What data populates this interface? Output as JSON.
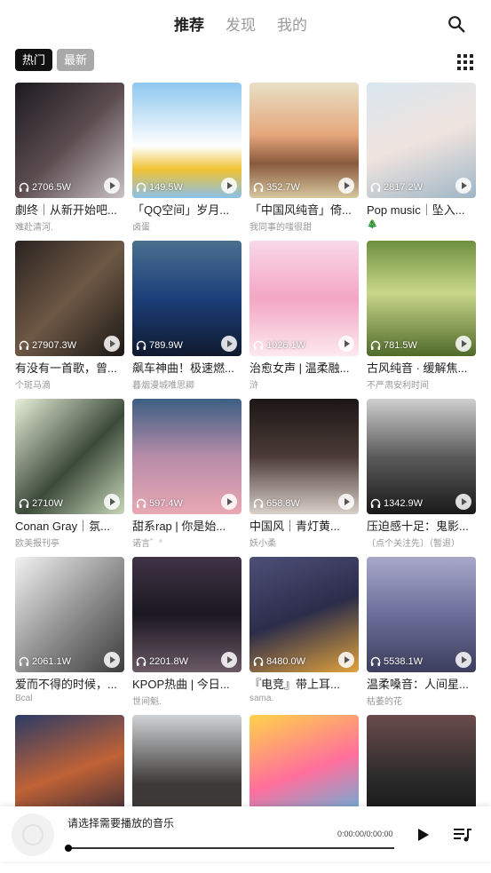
{
  "nav": {
    "tabs": [
      "推荐",
      "发现",
      "我的"
    ],
    "active": 0
  },
  "filters": {
    "hot": "热门",
    "new": "最新"
  },
  "colors": {
    "accent": "#111111",
    "chip_inactive": "#a9a9a9"
  },
  "playlists": [
    {
      "count": "2706.5W",
      "title": "劇终｜从新开始吧...",
      "sub": "难赴清河.",
      "bg": "linear-gradient(135deg,#1b1b1f,#5b4b4f 50%,#c9c1c5)"
    },
    {
      "count": "149.5W",
      "title": "「QQ空间」岁月...",
      "sub": "卤蛋",
      "bg": "linear-gradient(180deg,#8ec7ef,#fff 55%,#f0c233 75%,#8ac0e8)"
    },
    {
      "count": "352.7W",
      "title": "「中国风纯音」倚...",
      "sub": "我同事的嗤很甜",
      "bg": "linear-gradient(180deg,#e7e0c6,#e6a77c 45%,#8a5a3d 70%,#d6c79f)"
    },
    {
      "count": "2817.2W",
      "title": "Pop music｜坠入...",
      "sub": "🎄",
      "bg": "linear-gradient(160deg,#d9e6ef,#f0e4de 50%,#9fb6c6)"
    },
    {
      "count": "27907.3W",
      "title": "有没有一首歌，曾...",
      "sub": "个斑马滴",
      "bg": "linear-gradient(135deg,#2a2320,#6e5845 50%,#1c1816)"
    },
    {
      "count": "789.9W",
      "title": "飙车神曲！极速燃...",
      "sub": "暮烟漫城唯思卿",
      "bg": "linear-gradient(180deg,#4a6f8e,#1d3f7a 50%,#0f1a2e)"
    },
    {
      "count": "1026.1W",
      "title": "治愈女声 | 温柔融...",
      "sub": "浒",
      "bg": "linear-gradient(180deg,#f8d8e8,#f4a6c3 50%,#fce9ef)"
    },
    {
      "count": "781.5W",
      "title": "古风纯音 · 缓解焦...",
      "sub": "不严肃安利时间",
      "bg": "linear-gradient(180deg,#6d8f3e,#c9d78a 45%,#4f6a2a)"
    },
    {
      "count": "2710W",
      "title": "Conan Gray｜氛...",
      "sub": "欧美报刊亭",
      "bg": "linear-gradient(135deg,#e6efd8,#3c4a3a 55%,#c7d7b9)"
    },
    {
      "count": "597.4W",
      "title": "甜系rap | 你是始...",
      "sub": "诺言゛°",
      "bg": "linear-gradient(180deg,#3b5f83,#b78ca8 50%,#e9a8b4)"
    },
    {
      "count": "658.8W",
      "title": "中国风｜青灯黄...",
      "sub": "妖小柔",
      "bg": "linear-gradient(180deg,#1b1716,#4c3b37 50%,#d9cfc9)"
    },
    {
      "count": "1342.9W",
      "title": "压迫感十足：鬼影...",
      "sub": "〔点个关注先〕（暂退）",
      "bg": "linear-gradient(180deg,#cfcfcf,#5b5b5b 50%,#1a1a1a)"
    },
    {
      "count": "2061.1W",
      "title": "爱而不得的时候，...",
      "sub": "Bcal",
      "bg": "linear-gradient(135deg,#f2f2f2,#8a8a8a 55%,#3d3d3d)"
    },
    {
      "count": "2201.8W",
      "title": "KPOP热曲 | 今日...",
      "sub": "世间魁.",
      "bg": "linear-gradient(180deg,#3f3346,#1b1820 50%,#6b5a66)"
    },
    {
      "count": "8480.0W",
      "title": "『电竞』带上耳...",
      "sub": "sama.",
      "bg": "linear-gradient(160deg,#4d4f78,#2c2d4a 50%,#e1a23d)"
    },
    {
      "count": "5538.1W",
      "title": "温柔嗓音：人间星...",
      "sub": "枯萎的花",
      "bg": "linear-gradient(180deg,#a7a8c9,#6c6e9a 50%,#3c3e5c)"
    },
    {
      "count": "",
      "title": "",
      "sub": "",
      "bg": "linear-gradient(160deg,#2c3b66,#c06236 50%,#1d2138)"
    },
    {
      "count": "",
      "title": "",
      "sub": "",
      "bg": "linear-gradient(180deg,#cfd3d6,#3d3937 60%)"
    },
    {
      "count": "",
      "title": "",
      "sub": "",
      "bg": "linear-gradient(160deg,#ffd34a,#ff6e9c 50%,#3dc3e9)"
    },
    {
      "count": "",
      "title": "",
      "sub": "",
      "bg": "linear-gradient(180deg,#6b4b4b,#2a2a2a 55%,#111)"
    }
  ],
  "player": {
    "title": "请选择需要播放的音乐",
    "time": "0:00:00/0:00:00",
    "progress": 0
  }
}
